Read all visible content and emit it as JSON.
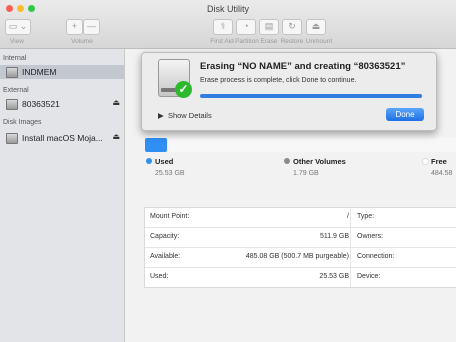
{
  "window": {
    "title": "Disk Utility",
    "traffic_colors": [
      "#fc5f57",
      "#fdbc2e",
      "#33c748"
    ]
  },
  "toolbar": {
    "view_label": "View",
    "volume_label": "Volume",
    "add_symbol": "+",
    "remove_symbol": "—",
    "actions": [
      "First Aid",
      "Partition",
      "Erase",
      "Restore",
      "Unmount"
    ]
  },
  "sidebar": {
    "internal_header": "Internal",
    "internal_item": "INDMEM",
    "external_header": "External",
    "external_item": "80363521",
    "images_header": "Disk Images",
    "images_item": "Install macOS Moja...",
    "eject_symbol": "⏏"
  },
  "dialog": {
    "title": "Erasing “NO NAME” and creating “80363521”",
    "message": "Erase process is complete, click Done to continue.",
    "progress_fraction": 1.0,
    "show_details": "Show Details",
    "done_label": "Done",
    "check_symbol": "✓"
  },
  "usage": {
    "used_label": "Used",
    "used_value": "25.53 GB",
    "other_label": "Other Volumes",
    "other_value": "1.79 GB",
    "free_label": "Free",
    "free_value": "484.58",
    "colors": {
      "used": "#2f8ff2",
      "other": "#8a8a8a",
      "free": "#ffffff"
    }
  },
  "info": {
    "rows": [
      {
        "label": "Mount Point:",
        "value": "/",
        "label2": "Type:"
      },
      {
        "label": "Capacity:",
        "value": "511.9 GB",
        "label2": "Owners:"
      },
      {
        "label": "Available:",
        "value": "485.08 GB (500.7 MB purgeable)",
        "label2": "Connection:"
      },
      {
        "label": "Used:",
        "value": "25.53 GB",
        "label2": "Device:"
      }
    ]
  }
}
